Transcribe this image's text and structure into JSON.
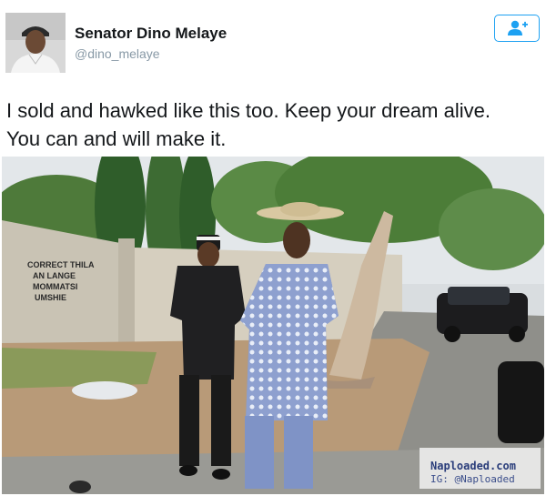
{
  "tweet": {
    "display_name": "Senator Dino Melaye",
    "handle": "@dino_melaye",
    "text_lines": [
      "I sold and hawked like this too. Keep your dream alive.",
      "You can and will make it."
    ]
  },
  "photo": {
    "wall_graffiti": [
      "CORRECT THILA",
      "AN LANGE",
      "MOMMATSI",
      "UMSHIE"
    ]
  },
  "watermark": {
    "line1": "Naploaded.com",
    "line2": "IG: @Naploaded"
  },
  "colors": {
    "accent": "#1da1f2",
    "name": "#14171a",
    "handle": "#8899a6"
  },
  "icons": {
    "follow": "add-user-icon"
  }
}
